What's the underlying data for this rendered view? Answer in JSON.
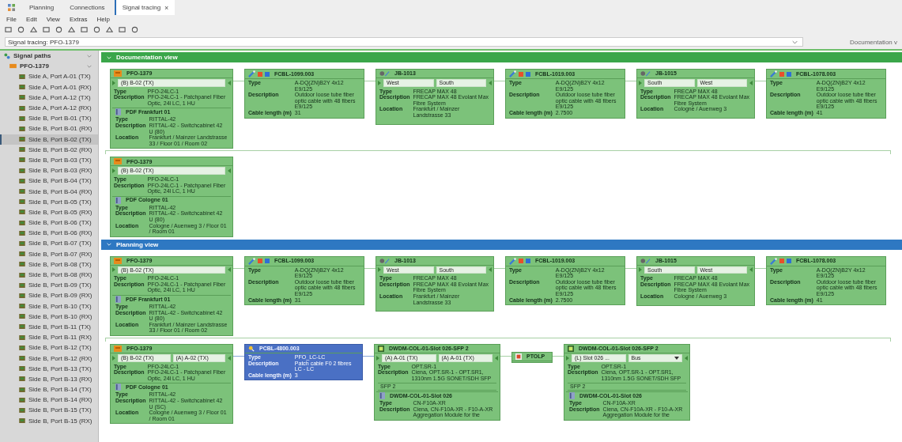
{
  "tabs": [
    {
      "label": "Planning",
      "selected": false,
      "closable": false
    },
    {
      "label": "Connections",
      "selected": false,
      "closable": false
    },
    {
      "label": "Signal tracing",
      "selected": true,
      "closable": true,
      "close": "×"
    }
  ],
  "menu": [
    "File",
    "Edit",
    "View",
    "Extras",
    "Help"
  ],
  "selector": {
    "value": "Signal tracing: PFO-1379",
    "right_label": "Documentation v"
  },
  "sidebar": {
    "label": "Signal paths",
    "expanded": true,
    "children": [
      {
        "label": "PFO-1379",
        "expanded": true,
        "children": [
          {
            "label": "Side A, Port A-01 (TX)",
            "selected": false
          },
          {
            "label": "Side A, Port A-01 (RX)",
            "selected": false
          },
          {
            "label": "Side A, Port A-12 (TX)",
            "selected": false
          },
          {
            "label": "Side A, Port A-12 (RX)",
            "selected": false
          },
          {
            "label": "Side B, Port B-01 (TX)",
            "selected": false
          },
          {
            "label": "Side B, Port B-01 (RX)",
            "selected": false
          },
          {
            "label": "Side B, Port B-02 (TX)",
            "selected": true
          },
          {
            "label": "Side B, Port B-02 (RX)",
            "selected": false
          },
          {
            "label": "Side B, Port B-03 (TX)",
            "selected": false
          },
          {
            "label": "Side B, Port B-03 (RX)",
            "selected": false
          },
          {
            "label": "Side B, Port B-04 (TX)",
            "selected": false
          },
          {
            "label": "Side B, Port B-04 (RX)",
            "selected": false
          },
          {
            "label": "Side B, Port B-05 (TX)",
            "selected": false
          },
          {
            "label": "Side B, Port B-05 (RX)",
            "selected": false
          },
          {
            "label": "Side B, Port B-06 (TX)",
            "selected": false
          },
          {
            "label": "Side B, Port B-06 (RX)",
            "selected": false
          },
          {
            "label": "Side B, Port B-07 (TX)",
            "selected": false
          },
          {
            "label": "Side B, Port B-07 (RX)",
            "selected": false
          },
          {
            "label": "Side B, Port B-08 (TX)",
            "selected": false
          },
          {
            "label": "Side B, Port B-08 (RX)",
            "selected": false
          },
          {
            "label": "Side B, Port B-09 (TX)",
            "selected": false
          },
          {
            "label": "Side B, Port B-09 (RX)",
            "selected": false
          },
          {
            "label": "Side B, Port B-10 (TX)",
            "selected": false
          },
          {
            "label": "Side B, Port B-10 (RX)",
            "selected": false
          },
          {
            "label": "Side B, Port B-11 (TX)",
            "selected": false
          },
          {
            "label": "Side B, Port B-11 (RX)",
            "selected": false
          },
          {
            "label": "Side B, Port B-12 (TX)",
            "selected": false
          },
          {
            "label": "Side B, Port B-12 (RX)",
            "selected": false
          },
          {
            "label": "Side B, Port B-13 (TX)",
            "selected": false
          },
          {
            "label": "Side B, Port B-13 (RX)",
            "selected": false
          },
          {
            "label": "Side B, Port B-14 (TX)",
            "selected": false
          },
          {
            "label": "Side B, Port B-14 (RX)",
            "selected": false
          },
          {
            "label": "Side B, Port B-15 (TX)",
            "selected": false
          },
          {
            "label": "Side B, Port B-15 (RX)",
            "selected": false
          }
        ]
      }
    ]
  },
  "views": [
    {
      "title": "Documentation view",
      "kind": "documentation",
      "expanded": true,
      "rows": [
        [
          {
            "kind": "panel",
            "title": "PFO-1379",
            "ports": [
              {
                "label": "(B) B-02 (TX)"
              }
            ],
            "fields": [
              {
                "label": "Type",
                "value": "PFO-24LC-1"
              },
              {
                "label": "Description",
                "value": "PFO-24LC-1 - Patchpanel Fiber Optic, 24l LC, 1 HU"
              }
            ],
            "sub": {
              "title": "PDF Frankfurt 01",
              "fields": [
                {
                  "label": "Type",
                  "value": "RITTAL-42"
                },
                {
                  "label": "Description",
                  "value": "RITTAL-42 - Switchcabinet 42 U (80)"
                },
                {
                  "label": "Location",
                  "value": "Frankfurt / Mainzer Landstrasse 33 / Floor 01 / Room 02"
                }
              ]
            }
          },
          {
            "kind": "cable",
            "title": "FCBL-1099.003",
            "fields": [
              {
                "label": "Type",
                "value": "A-DQ(ZN)B2Y 4x12 E9/125"
              },
              {
                "label": "Description",
                "value": "Outdoor loose tube fiber optic cable with 48 fibers E9/125"
              },
              {
                "label": "Cable length (m)",
                "value": "31"
              }
            ]
          },
          {
            "kind": "joint",
            "title": "JB-1013",
            "ports": [
              {
                "label": "West"
              },
              {
                "label": "South"
              }
            ],
            "fields": [
              {
                "label": "Type",
                "value": "FRECAP MAX 48"
              },
              {
                "label": "Description",
                "value": "FRECAP MAX 48 Evolant Max Fibre System"
              },
              {
                "label": "Location",
                "value": "Frankfurt / Mainzer Landstrasse 33"
              }
            ]
          },
          {
            "kind": "cable",
            "title": "FCBL-1019.003",
            "fields": [
              {
                "label": "Type",
                "value": "A-DQ(ZN)B2Y 4x12 E9/125"
              },
              {
                "label": "Description",
                "value": "Outdoor loose tube fiber optic cable with 48 fibers E9/125"
              },
              {
                "label": "Cable length (m)",
                "value": "2.7500"
              }
            ]
          },
          {
            "kind": "joint",
            "title": "JB-1015",
            "ports": [
              {
                "label": "South"
              },
              {
                "label": "West"
              }
            ],
            "fields": [
              {
                "label": "Type",
                "value": "FRECAP MAX 48"
              },
              {
                "label": "Description",
                "value": "FRECAP MAX 48 Evolant Max Fibre System"
              },
              {
                "label": "Location",
                "value": "Cologne / Auenweg 3"
              }
            ]
          },
          {
            "kind": "cable",
            "title": "FCBL-1078.003",
            "fields": [
              {
                "label": "Type",
                "value": "A-DQ(ZN)B2Y 4x12 E9/125"
              },
              {
                "label": "Description",
                "value": "Outdoor loose tube fiber optic cable with 48 fibers E9/125"
              },
              {
                "label": "Cable length (m)",
                "value": "41"
              }
            ]
          }
        ],
        [
          {
            "kind": "panel",
            "title": "PFO-1379",
            "ports": [
              {
                "label": "(B) B-02 (TX)"
              }
            ],
            "fields": [
              {
                "label": "Type",
                "value": "PFO-24LC-1"
              },
              {
                "label": "Description",
                "value": "PFO-24LC-1 - Patchpanel Fiber Optic, 24l LC, 1 HU"
              }
            ],
            "sub": {
              "title": "PDF Cologne 01",
              "fields": [
                {
                  "label": "Type",
                  "value": "RITTAL-42"
                },
                {
                  "label": "Description",
                  "value": "RITTAL-42 - Switchcabinet 42 U (80)"
                },
                {
                  "label": "Location",
                  "value": "Cologne / Auenweg 3 / Floor 01 / Room 01"
                }
              ]
            }
          }
        ]
      ]
    },
    {
      "title": "Planning view",
      "kind": "planning",
      "expanded": true,
      "rows": [
        [
          {
            "kind": "panel",
            "title": "PFO-1379",
            "ports": [
              {
                "label": "(B) B-02 (TX)"
              }
            ],
            "fields": [
              {
                "label": "Type",
                "value": "PFO-24LC-1"
              },
              {
                "label": "Description",
                "value": "PFO-24LC-1 - Patchpanel Fiber Optic, 24l LC, 1 HU"
              }
            ],
            "sub": {
              "title": "PDF Frankfurt 01",
              "fields": [
                {
                  "label": "Type",
                  "value": "RITTAL-42"
                },
                {
                  "label": "Description",
                  "value": "RITTAL-42 - Switchcabinet 42 U (80)"
                },
                {
                  "label": "Location",
                  "value": "Frankfurt / Mainzer Landstrasse 33 / Floor 01 / Room 02"
                }
              ]
            }
          },
          {
            "kind": "cable",
            "title": "FCBL-1099.003",
            "fields": [
              {
                "label": "Type",
                "value": "A-DQ(ZN)B2Y 4x12 E9/125"
              },
              {
                "label": "Description",
                "value": "Outdoor loose tube fiber optic cable with 48 fibers E9/125"
              },
              {
                "label": "Cable length (m)",
                "value": "31"
              }
            ]
          },
          {
            "kind": "joint",
            "title": "JB-1013",
            "ports": [
              {
                "label": "West"
              },
              {
                "label": "South"
              }
            ],
            "fields": [
              {
                "label": "Type",
                "value": "FRECAP MAX 48"
              },
              {
                "label": "Description",
                "value": "FRECAP MAX 48 Evolant Max Fibre System"
              },
              {
                "label": "Location",
                "value": "Frankfurt / Mainzer Landstrasse 33"
              }
            ]
          },
          {
            "kind": "cable",
            "title": "FCBL-1019.003",
            "fields": [
              {
                "label": "Type",
                "value": "A-DQ(ZN)B2Y 4x12 E9/125"
              },
              {
                "label": "Description",
                "value": "Outdoor loose tube fiber optic cable with 48 fibers E9/125"
              },
              {
                "label": "Cable length (m)",
                "value": "2.7500"
              }
            ]
          },
          {
            "kind": "joint",
            "title": "JB-1015",
            "ports": [
              {
                "label": "South"
              },
              {
                "label": "West"
              }
            ],
            "fields": [
              {
                "label": "Type",
                "value": "FRECAP MAX 48"
              },
              {
                "label": "Description",
                "value": "FRECAP MAX 48 Evolant Max Fibre System"
              },
              {
                "label": "Location",
                "value": "Cologne / Auenweg 3"
              }
            ]
          },
          {
            "kind": "cable",
            "title": "FCBL-1078.003",
            "fields": [
              {
                "label": "Type",
                "value": "A-DQ(ZN)B2Y 4x12 E9/125"
              },
              {
                "label": "Description",
                "value": "Outdoor loose tube fiber optic cable with 48 fibers E9/125"
              },
              {
                "label": "Cable length (m)",
                "value": "41"
              }
            ]
          }
        ],
        [
          {
            "kind": "panel",
            "title": "PFO-1379",
            "ports": [
              {
                "label": "(B) B-02 (TX)"
              },
              {
                "label": "(A) A-02 (TX)"
              }
            ],
            "fields": [
              {
                "label": "Type",
                "value": "PFO-24LC-1"
              },
              {
                "label": "Description",
                "value": "PFO-24LC-1 - Patchpanel Fiber Optic, 24l LC, 1 HU"
              }
            ],
            "sub": {
              "title": "PDF Cologne 01",
              "fields": [
                {
                  "label": "Type",
                  "value": "RITTAL-42"
                },
                {
                  "label": "Description",
                  "value": "RITTAL-42 - Switchcabinet 42 U (SC)"
                },
                {
                  "label": "Location",
                  "value": "Cologne / Auenweg 3 / Floor 01 / Room 01"
                }
              ]
            }
          },
          {
            "kind": "patch",
            "title": "PCBL-4800.003",
            "fields": [
              {
                "label": "Type",
                "value": "PFO_LC-LC"
              },
              {
                "label": "Description",
                "value": "Patch cable F0 2 fibres LC - LC"
              },
              {
                "label": "Cable length (m)",
                "value": "3"
              }
            ]
          },
          {
            "kind": "device",
            "title": "DWDM-COL-01-Slot 026-SFP 2",
            "ports": [
              {
                "label": "(A) A-01 (TX)"
              },
              {
                "label": "(A) A-01 (TX)"
              }
            ],
            "fields": [
              {
                "label": "Type",
                "value": "OPT.SR-1"
              },
              {
                "label": "Description",
                "value": "Ciena, OPT.SR-1 - OPT.SR1, 1310nm 1.5G SONET/SDH SFP"
              }
            ],
            "extras": [
              "SFP 2"
            ],
            "sub": {
              "title": "DWDM-COL-01-Slot 026",
              "fields": [
                {
                  "label": "Type",
                  "value": "CN-F10A-XR"
                },
                {
                  "label": "Description",
                  "value": "Ciena, CN-F10A-XR - F10-A-XR Aggregation Module for the"
                }
              ]
            }
          },
          {
            "kind": "amp",
            "title": "PTOLP"
          },
          {
            "kind": "device",
            "title": "DWDM-COL-01-Slot 026-SFP 2",
            "ports": [
              {
                "label": "(L) Slot 026 ..."
              },
              {
                "label": "Bus",
                "dropdown": true
              }
            ],
            "fields": [
              {
                "label": "Type",
                "value": "OPT.SR-1"
              },
              {
                "label": "Description",
                "value": "Ciena, OPT.SR-1 - OPT.SR1, 1310nm 1.5G SONET/SDH SFP"
              }
            ],
            "extras": [
              "SFP 2"
            ],
            "sub": {
              "title": "DWDM-COL-01-Slot 026",
              "fields": [
                {
                  "label": "Type",
                  "value": "CN-F10A-XR"
                },
                {
                  "label": "Description",
                  "value": "Ciena, CN-F10A-XR - F10-A-XR Aggregation Module for the"
                }
              ]
            }
          }
        ]
      ]
    }
  ]
}
